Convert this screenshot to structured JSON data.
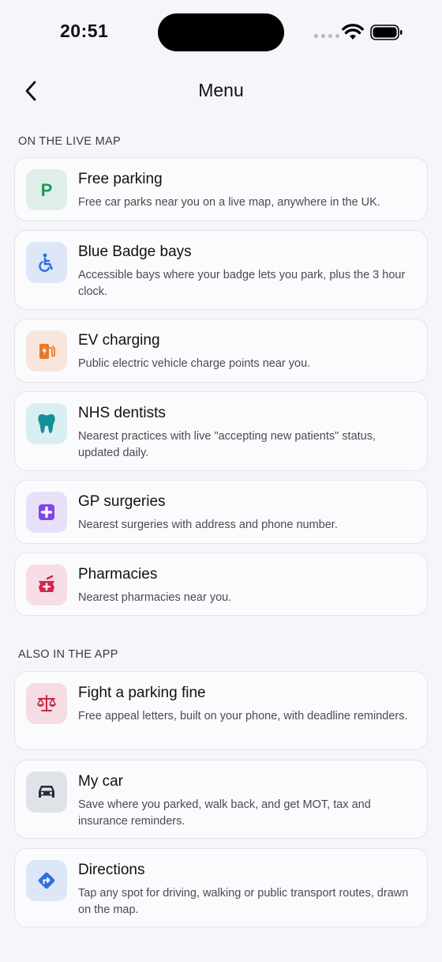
{
  "status_bar": {
    "time": "20:51"
  },
  "nav": {
    "title": "Menu"
  },
  "sections": [
    {
      "header": "ON THE LIVE MAP",
      "items": [
        {
          "title": "Free parking",
          "description": "Free car parks near you on a live map, anywhere in the UK.",
          "icon": "parking-icon",
          "icon_bg": "#dfeee9",
          "icon_color": "#1f9a5a"
        },
        {
          "title": "Blue Badge bays",
          "description": "Accessible bays where your badge lets you park, plus the 3 hour clock.",
          "icon": "wheelchair-icon",
          "icon_bg": "#dde7f8",
          "icon_color": "#2f6fe0"
        },
        {
          "title": "EV charging",
          "description": "Public electric vehicle charge points near you.",
          "icon": "ev-charger-icon",
          "icon_bg": "#f8e6dd",
          "icon_color": "#e8792a"
        },
        {
          "title": "NHS dentists",
          "description": "Nearest practices with live \"accepting new patients\" status, updated daily.",
          "icon": "tooth-icon",
          "icon_bg": "#d9eef0",
          "icon_color": "#148f96"
        },
        {
          "title": "GP surgeries",
          "description": "Nearest surgeries with address and phone number.",
          "icon": "medical-cross-icon",
          "icon_bg": "#e8e0f8",
          "icon_color": "#8244e6"
        },
        {
          "title": "Pharmacies",
          "description": "Nearest pharmacies near you.",
          "icon": "pharmacy-icon",
          "icon_bg": "#f7dde5",
          "icon_color": "#d8244e"
        }
      ]
    },
    {
      "header": "ALSO IN THE APP",
      "items": [
        {
          "title": "Fight a parking fine",
          "description": "Free appeal letters, built on your phone, with deadline reminders.",
          "icon": "scales-icon",
          "icon_bg": "#f5dde3",
          "icon_color": "#c82a45"
        },
        {
          "title": "My car",
          "description": "Save where you parked, walk back, and get MOT, tax and insurance reminders.",
          "icon": "car-icon",
          "icon_bg": "#e0e2ea",
          "icon_color": "#262a36"
        },
        {
          "title": "Directions",
          "description": "Tap any spot for driving, walking or public transport routes, drawn on the map.",
          "icon": "directions-icon",
          "icon_bg": "#dde7f8",
          "icon_color": "#2f6fe0"
        }
      ]
    }
  ]
}
